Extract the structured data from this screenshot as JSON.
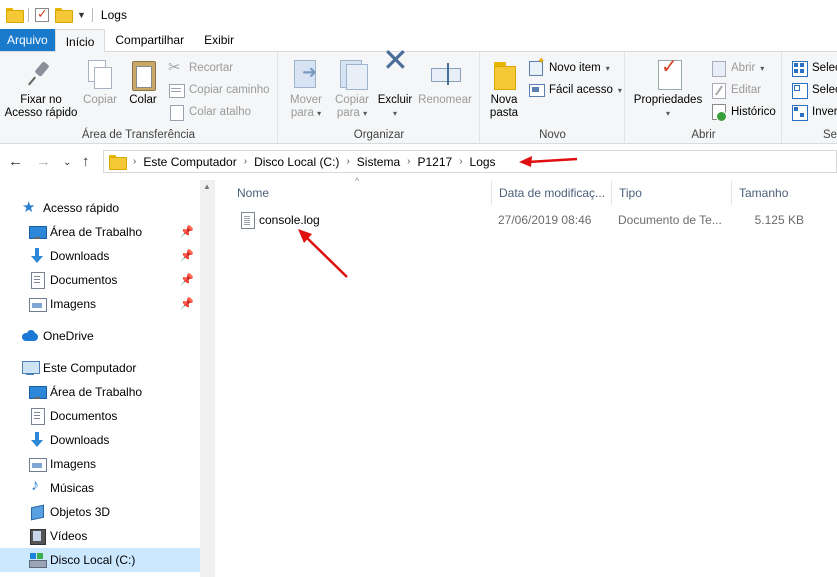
{
  "window": {
    "title": "Logs"
  },
  "ribbon_tabs": [
    "Arquivo",
    "Início",
    "Compartilhar",
    "Exibir"
  ],
  "clipboard": {
    "pin_label_1": "Fixar no",
    "pin_label_2": "Acesso rápido",
    "copy": "Copiar",
    "paste": "Colar",
    "cut": "Recortar",
    "copy_path": "Copiar caminho",
    "paste_shortcut": "Colar atalho",
    "group": "Área de Transferência"
  },
  "organize": {
    "move_1": "Mover",
    "move_2": "para",
    "copyto_1": "Copiar",
    "copyto_2": "para",
    "delete": "Excluir",
    "rename": "Renomear",
    "group": "Organizar"
  },
  "new": {
    "new_folder_1": "Nova",
    "new_folder_2": "pasta",
    "new_item": "Novo item",
    "easy_access": "Fácil acesso",
    "group": "Novo"
  },
  "open": {
    "properties": "Propriedades",
    "open": "Abrir",
    "edit": "Editar",
    "history": "Histórico",
    "group": "Abrir"
  },
  "select": {
    "select_all": "Selec",
    "select_none": "Selec",
    "invert": "Inver",
    "group": "Se"
  },
  "address": {
    "crumbs": [
      "Este Computador",
      "Disco Local (C:)",
      "Sistema",
      "P1217",
      "Logs"
    ]
  },
  "nav": {
    "quick_access": "Acesso rápido",
    "qa_items": [
      "Área de Trabalho",
      "Downloads",
      "Documentos",
      "Imagens"
    ],
    "onedrive": "OneDrive",
    "this_pc": "Este Computador",
    "pc_items": [
      "Área de Trabalho",
      "Documentos",
      "Downloads",
      "Imagens",
      "Músicas",
      "Objetos 3D",
      "Vídeos",
      "Disco Local (C:)"
    ]
  },
  "list": {
    "columns": [
      "Nome",
      "Data de modificaç...",
      "Tipo",
      "Tamanho"
    ],
    "rows": [
      {
        "name": "console.log",
        "modified": "27/06/2019 08:46",
        "type": "Documento de Te...",
        "size": "5.125 KB"
      }
    ]
  },
  "colors": {
    "file_tab": "#1979ca",
    "selected_nav": "#cce8ff",
    "annotation_arrow": "#e01010"
  }
}
